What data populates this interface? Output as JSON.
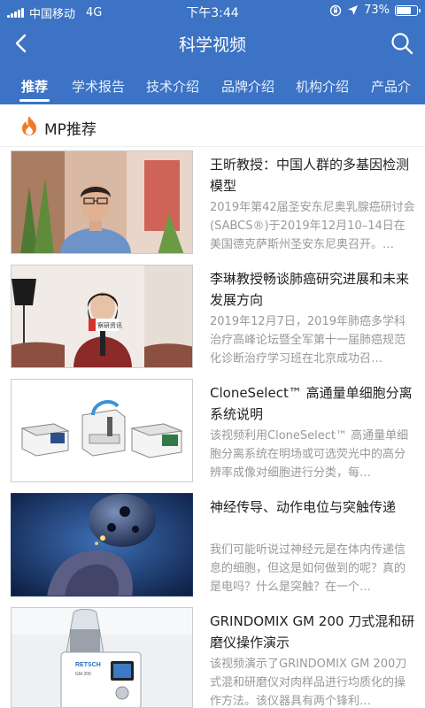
{
  "status": {
    "carrier": "中国移动",
    "network": "4G",
    "time": "下午3:44",
    "battery": "73%"
  },
  "nav": {
    "title": "科学视频",
    "back_icon": "chevron-left-icon",
    "search_icon": "search-icon"
  },
  "tabs": [
    {
      "label": "推荐",
      "active": true
    },
    {
      "label": "学术报告",
      "active": false
    },
    {
      "label": "技术介绍",
      "active": false
    },
    {
      "label": "品牌介绍",
      "active": false
    },
    {
      "label": "机构介绍",
      "active": false
    },
    {
      "label": "产品介",
      "active": false
    }
  ],
  "section": {
    "title": "MP推荐",
    "icon": "flame-icon"
  },
  "videos": [
    {
      "title": "王昕教授：中国人群的多基因检测模型",
      "desc": "2019年第42届圣安东尼奥乳腺癌研讨会(SABCS®)于2019年12月10–14日在美国德克萨斯州圣安东尼奥召开。…"
    },
    {
      "title": "李琳教授畅谈肺癌研究进展和未来发展方向",
      "desc": "2019年12月7日，2019年肺癌多学科治疗高峰论坛暨全军第十一届肺癌规范化诊断治疗学习班在北京成功召…"
    },
    {
      "title": "CloneSelect™ 高通量单细胞分离系统说明",
      "desc": "该视频利用CloneSelect™ 高通量单细胞分离系统在明场或可选荧光中的高分辨率成像对细胞进行分类，每…"
    },
    {
      "title": "神经传导、动作电位与突触传递",
      "desc": "我们可能听说过神经元是在体内传递信息的细胞，但这是如何做到的呢？真的是电吗？什么是突触？在一个…"
    },
    {
      "title": "GRINDOMIX GM 200 刀式混和研磨仪操作演示",
      "desc": "该视频演示了GRINDOMIX GM 200刀式混和研磨仪对肉样品进行均质化的操作方法。该仪器具有两个锋利…"
    }
  ],
  "thumb_text": {
    "badge": "察研资讯",
    "retsch": "RETSCH",
    "gm": "GM 200"
  },
  "colors": {
    "header": "#3c73c4",
    "title_text": "#222222",
    "desc_text": "#999999"
  }
}
